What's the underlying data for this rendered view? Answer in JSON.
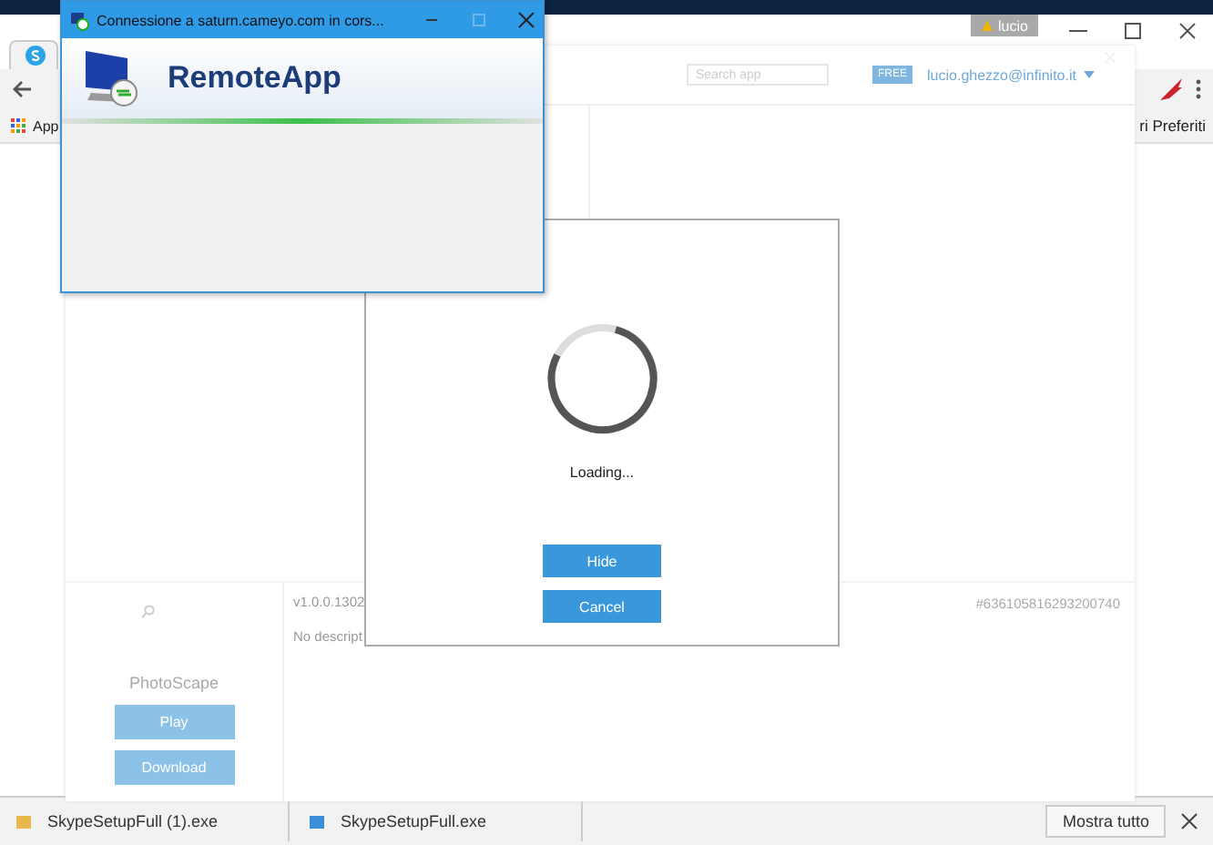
{
  "browser": {
    "user_chip": "lucio",
    "bookmarks": [
      {
        "label": "App"
      },
      {
        "label": "ri Preferiti"
      }
    ],
    "downloads": [
      {
        "file": "SkypeSetupFull (1).exe"
      },
      {
        "file": "SkypeSetupFull.exe"
      }
    ],
    "show_all": "Mostra tutto"
  },
  "cameyo": {
    "search": {
      "placeholder": "Search app"
    },
    "plan_badge": "FREE",
    "account": "lucio.ghezzo@infinito.it",
    "app": {
      "name": "PhotoScape",
      "version": "v1.0.0.1302",
      "description": "No descript",
      "id": "#636105816293200740"
    },
    "buttons": [
      {
        "label": "Play",
        "disabled": true
      },
      {
        "label": "Download",
        "disabled": true
      }
    ]
  },
  "dialog": {
    "message": "Loading...",
    "buttons": [
      "Hide",
      "Cancel"
    ]
  },
  "remoteapp": {
    "title": "Connessione a saturn.cameyo.com in cors...",
    "heading": "RemoteApp"
  }
}
